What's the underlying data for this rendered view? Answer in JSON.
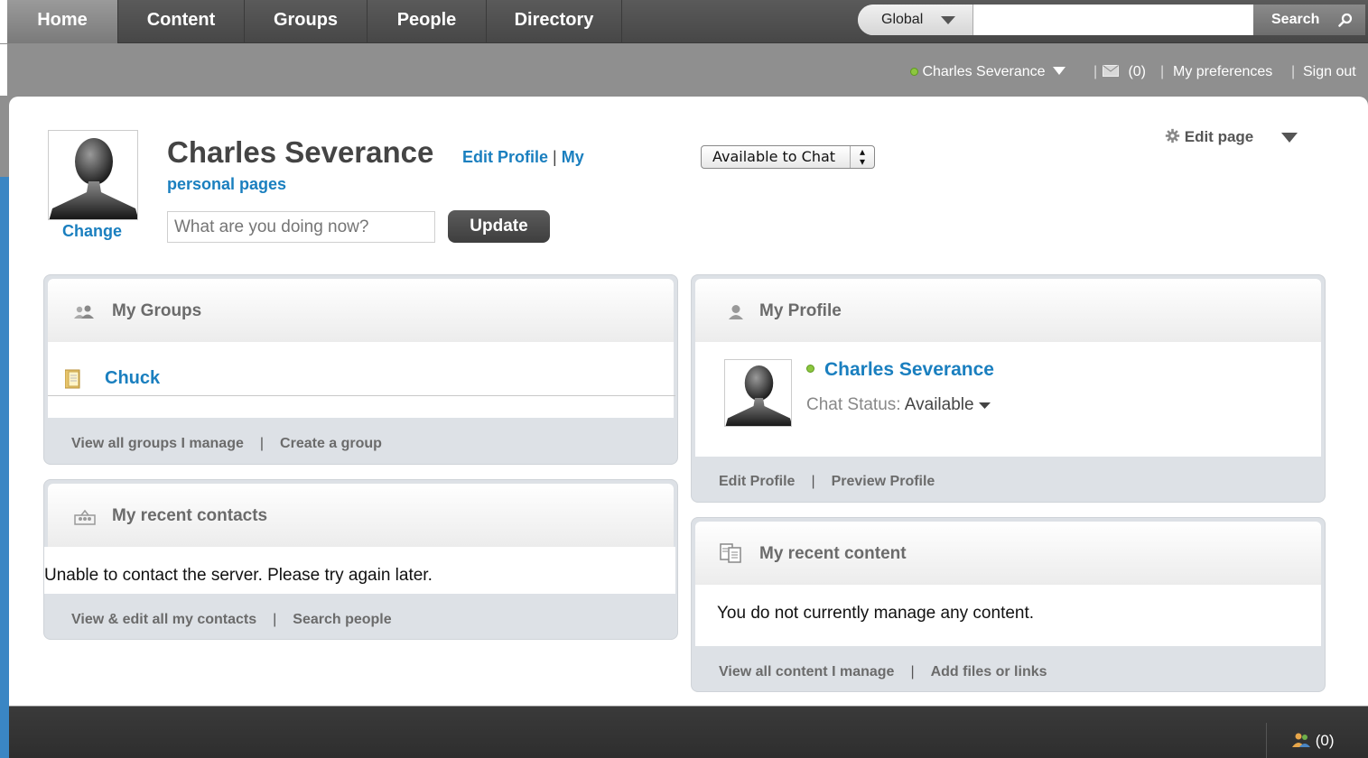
{
  "nav": {
    "tabs": [
      {
        "label": "Home",
        "active": true
      },
      {
        "label": "Content",
        "active": false
      },
      {
        "label": "Groups",
        "active": false
      },
      {
        "label": "People",
        "active": false
      },
      {
        "label": "Directory",
        "active": false
      }
    ],
    "search": {
      "scope": "Global",
      "placeholder": "",
      "button": "Search"
    }
  },
  "utility": {
    "user": "Charles Severance",
    "mail_count": "(0)",
    "preferences": "My preferences",
    "sign_out": "Sign out",
    "separator": "|"
  },
  "profile": {
    "name": "Charles Severance",
    "edit_profile": "Edit Profile",
    "separator": "|",
    "my": "My",
    "personal_pages": "personal pages",
    "change": "Change",
    "status_placeholder": "What are you doing now?",
    "update": "Update",
    "chat_status": "Available to Chat",
    "edit_page": "Edit page"
  },
  "my_groups": {
    "title": "My Groups",
    "items": [
      "Chuck"
    ],
    "footer": [
      "View all groups I manage",
      "Create a group"
    ]
  },
  "my_contacts": {
    "title": "My recent contacts",
    "message": "Unable to contact the server. Please try again later.",
    "footer": [
      "View & edit all my contacts",
      "Search people"
    ]
  },
  "my_profile": {
    "title": "My Profile",
    "name": "Charles Severance",
    "chat_label": "Chat Status:",
    "chat_value": "Available",
    "footer": [
      "Edit Profile",
      "Preview Profile"
    ]
  },
  "my_content": {
    "title": "My recent content",
    "message": "You do not currently manage any content.",
    "footer": [
      "View all content I manage",
      "Add files or links"
    ]
  },
  "bottom": {
    "chat_count": "(0)"
  },
  "colors": {
    "link": "#1a7fbf",
    "online": "#8cc63f",
    "nav_bg": "#474747"
  }
}
